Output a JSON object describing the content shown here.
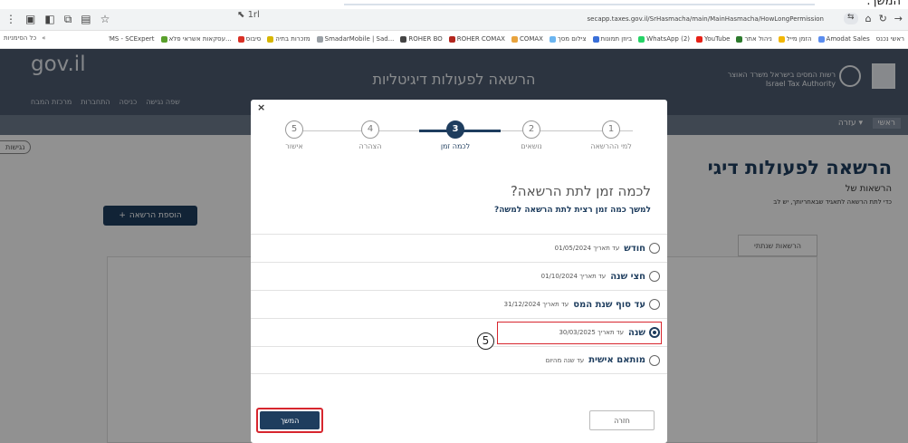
{
  "caption": {
    "text": "המשך."
  },
  "browser": {
    "url": "secapp.taxes.gov.il/SrHasmacha/main/MainHasmacha/HowLongPermission",
    "bookmarks_left": [
      "כל הסימניות",
      "«"
    ],
    "bookmarks": [
      "ראשי נכנס",
      "Amodat Sales",
      "הזמן מייל",
      "ניהול אתר",
      "YouTube",
      "WhatsApp (2)",
      "ביוזן תמונות",
      "צילום מסך",
      "COMAX",
      "ROHER COMAX",
      "ROHER BO",
      "SmadarMobile | Sad...",
      "מזכרות בתיה",
      "סיבוס",
      "עסקאות אשראי פלא...",
      "WMS - SCExpert"
    ],
    "ext_pill": "1rl"
  },
  "header": {
    "logo": "gov.il",
    "links": [
      "שפה נגישה",
      "כניסה",
      "התחברות",
      "מרכזת המבח"
    ],
    "title": "הרשאה לפעולות דיגיטליות",
    "authority_he": "רשות המסים בישראל משרד האוצר",
    "authority_en": "Israel Tax Authority"
  },
  "nav": {
    "home": "ראשי",
    "help": "עזרה ▾"
  },
  "page": {
    "accessibility": "נגישות",
    "title": "הרשאה לפעולות דיגי",
    "sub": "הרשאות של",
    "note": "כדי לתת הרשאה לתאגיד שבאחריותך, יש לב",
    "add_button": "הוספת הרשאה",
    "tab": "הרשאות שנתתי"
  },
  "modal": {
    "close": "×",
    "steps": [
      {
        "num": "1",
        "label": "למי ההרשאה"
      },
      {
        "num": "2",
        "label": "נושאים"
      },
      {
        "num": "3",
        "label": "לכמה זמן"
      },
      {
        "num": "4",
        "label": "הצהרה"
      },
      {
        "num": "5",
        "label": "אישור"
      }
    ],
    "active_step": 3,
    "question": "לכמה זמן לתת הרשאה?",
    "question_sub": "למשך כמה זמן רצית לתת הרשאה למשה?",
    "options": [
      {
        "label": "חודש",
        "date": "עד תאריך 01/05/2024",
        "checked": false
      },
      {
        "label": "חצי שנה",
        "date": "עד תאריך 01/10/2024",
        "checked": false
      },
      {
        "label": "עד סוף שנת המס",
        "date": "עד תאריך 31/12/2024",
        "checked": false
      },
      {
        "label": "שנה",
        "date": "עד תאריך 30/03/2025",
        "checked": true
      },
      {
        "label": "מותאם אישית",
        "date": "עד שנה מהיום",
        "checked": false
      }
    ],
    "marker": "5",
    "next_button": "המשך",
    "back_button": "חזרה"
  }
}
